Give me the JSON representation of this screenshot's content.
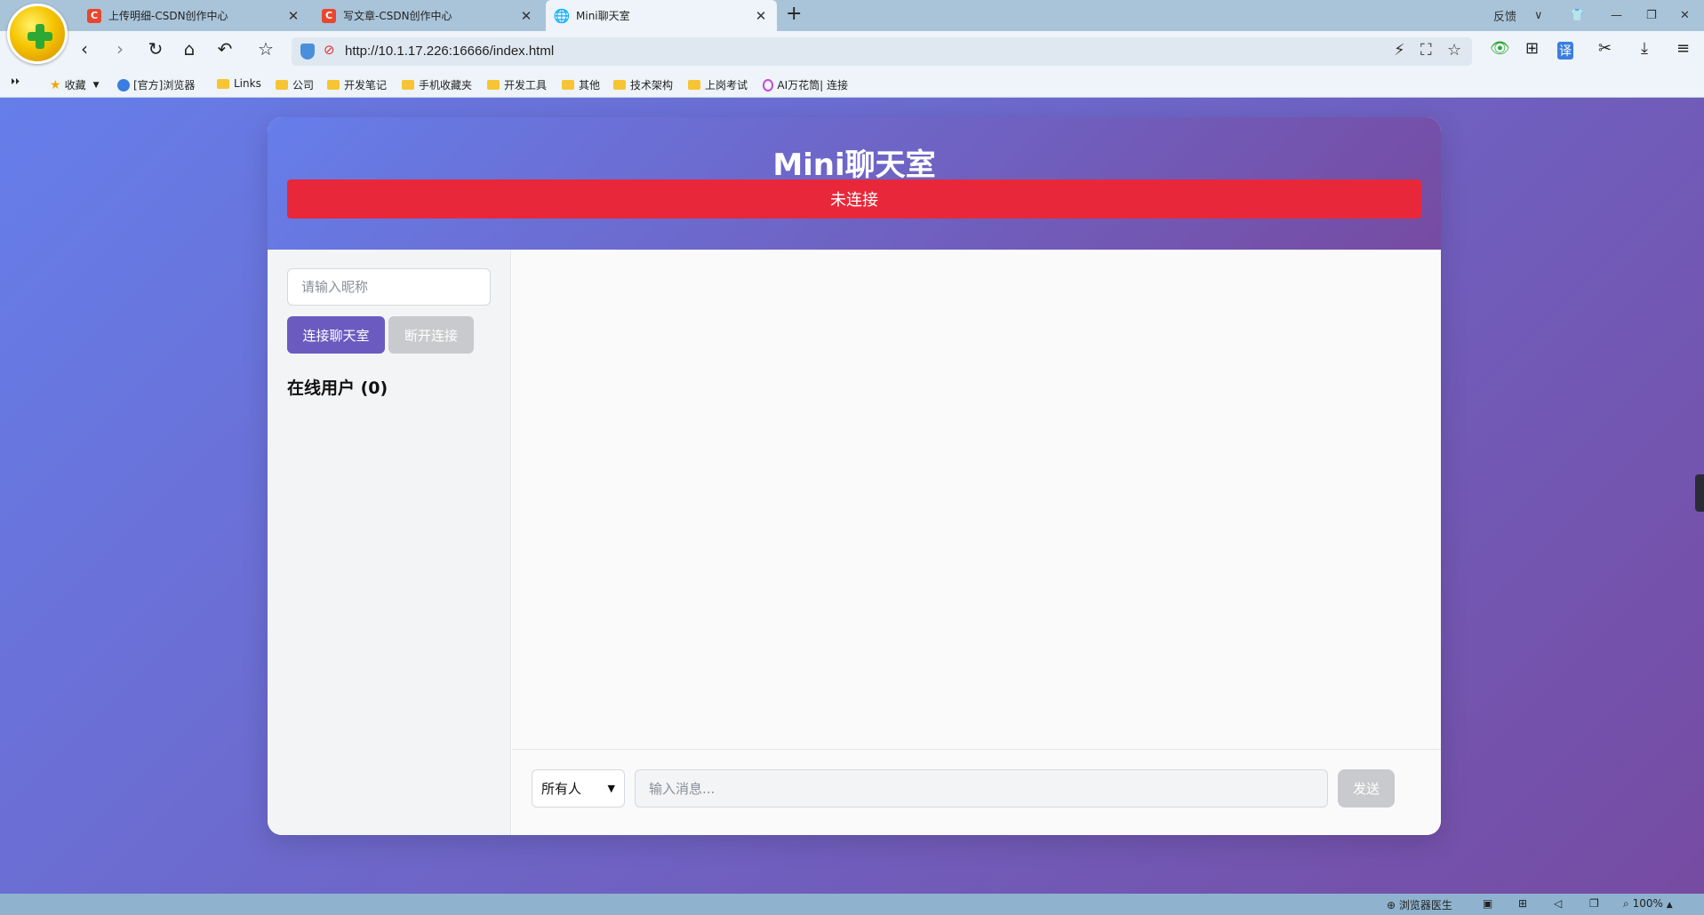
{
  "browser": {
    "tabs": [
      {
        "favicon": "C",
        "title": "上传明细-CSDN创作中心",
        "close": "✕"
      },
      {
        "favicon": "C",
        "title": "写文章-CSDN创作中心",
        "close": "✕"
      },
      {
        "favicon": "🌐",
        "title": "Mini聊天室",
        "close": "✕"
      }
    ],
    "new_tab": "+",
    "window_controls": {
      "feedback": "反馈",
      "menu": "∨",
      "skin": "👕",
      "minimize": "—",
      "restore": "❐",
      "close": "✕"
    },
    "nav": {
      "back": "‹",
      "forward": "›",
      "reload": "↻",
      "home": "⌂",
      "undo": "↶",
      "favorites": "☆"
    },
    "address": {
      "url": "http://10.1.17.226:16666/index.html"
    },
    "address_icons": {
      "boost": "⚡",
      "screenshot": "⛶",
      "bookmark": "☆"
    },
    "toolbar": {
      "eye": "👁",
      "apps": "⊞",
      "translate": "译",
      "cut": "✂",
      "download": "⤓",
      "menu": "≡"
    },
    "bookmarks": {
      "toggle": "⏵⏵",
      "favorites_label": "收藏",
      "items": [
        "[官方]浏览器",
        "Links",
        "公司",
        "开发笔记",
        "手机收藏夹",
        "开发工具",
        "其他",
        "技术架构",
        "上岗考试",
        "AI万花筒| 连接"
      ]
    },
    "status": {
      "doctor": "浏览器医生",
      "zoom": "100%"
    }
  },
  "colors": {
    "gradient_start": "#667eea",
    "gradient_end": "#764ba2",
    "status_disconnected": "#e8283a",
    "button_primary": "#6b5bc0",
    "button_disabled": "#c9cacd"
  },
  "chat": {
    "title": "Mini聊天室",
    "status": "未连接",
    "nickname_placeholder": "请输入昵称",
    "connect_label": "连接聊天室",
    "disconnect_label": "断开连接",
    "online_users_title": "在线用户 (0)",
    "target_selected": "所有人",
    "message_placeholder": "输入消息...",
    "send_label": "发送"
  }
}
